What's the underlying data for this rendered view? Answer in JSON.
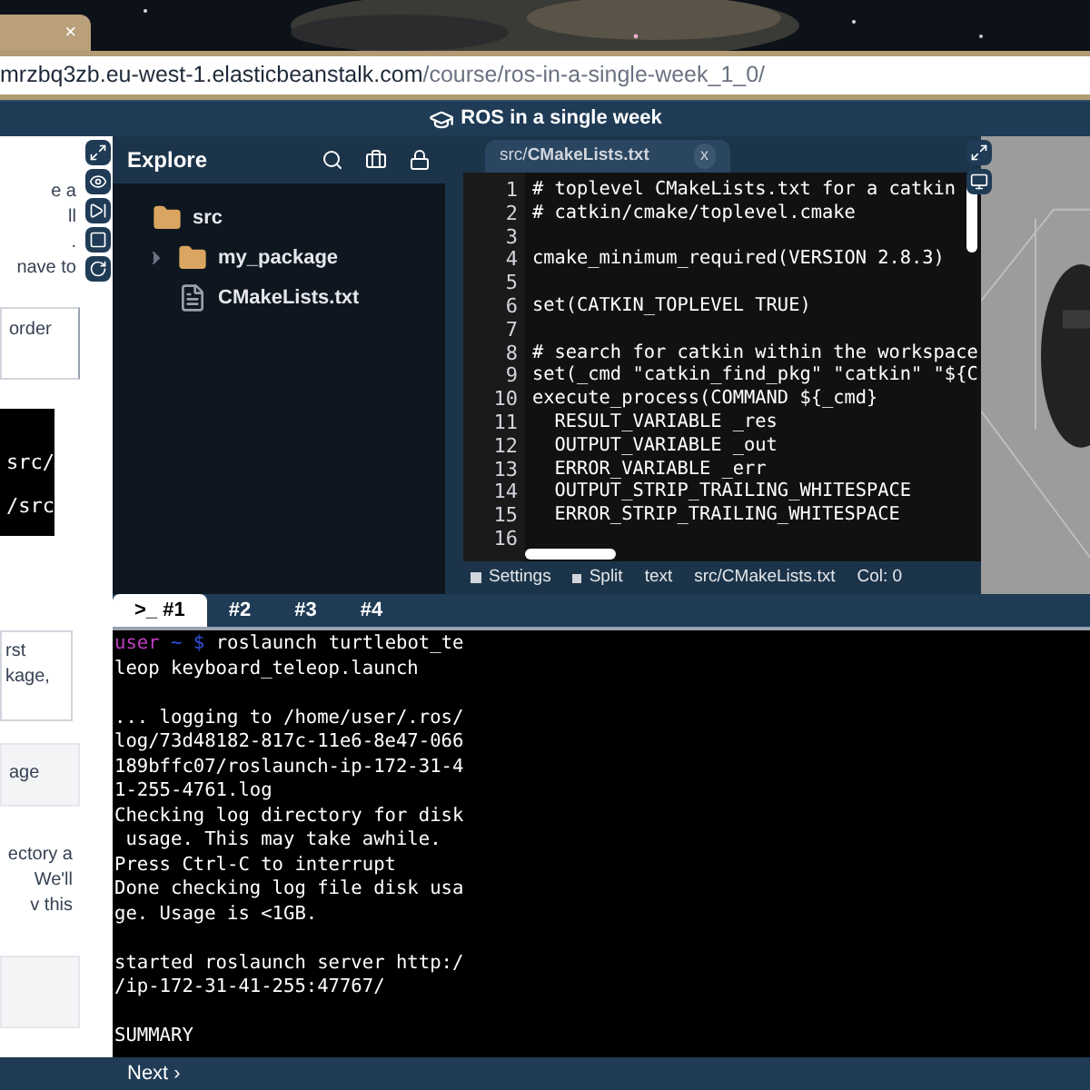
{
  "browser": {
    "tab_close": "×",
    "url_host": "mrzbq3zb.eu-west-1.elasticbeanstalk.com",
    "url_path": "/course/ros-in-a-single-week_1_0/"
  },
  "header": {
    "title": "ROS in a single week"
  },
  "lesson": {
    "upper_text": [
      "e a",
      "ll",
      ".",
      "nave to"
    ],
    "upper_box": "order",
    "code_lines": [
      "src/",
      "/src"
    ],
    "lower_box": [
      "rst",
      "kage,"
    ],
    "grey_box": "age",
    "lower_text": [
      "ectory a",
      "We'll",
      "v this"
    ]
  },
  "explorer": {
    "title": "Explore",
    "tree": [
      {
        "name": "src",
        "kind": "folder",
        "children": [
          {
            "name": "my_package",
            "kind": "folder",
            "expanded": false
          },
          {
            "name": "CMakeLists.txt",
            "kind": "file"
          }
        ]
      }
    ]
  },
  "editor": {
    "tab": "src/**CMakeLists.txt**",
    "close": "x",
    "lines": [
      {
        "number": "1",
        "code": "# toplevel CMakeLists.txt for a catkin"
      },
      {
        "number": "2",
        "code": "# catkin/cmake/toplevel.cmake"
      },
      {
        "number": "3"
      },
      {
        "number": "4",
        "code": "cmake_minimum_required(VERSION 2.8.3)"
      },
      {
        "number": "5"
      },
      {
        "number": "6",
        "code": "set(CATKIN_TOPLEVEL TRUE)"
      },
      {
        "number": "7"
      },
      {
        "number": "8",
        "code": "# search for catkin within the workspace"
      },
      {
        "number": "9",
        "code": "set(_cmd \"catkin_find_pkg\" \"catkin\" \"${C"
      },
      {
        "number": "10",
        "code": "execute_process(COMMAND ${_cmd}"
      },
      {
        "number": "11",
        "code": "  RESULT_VARIABLE _res"
      },
      {
        "number": "12",
        "code": "  OUTPUT_VARIABLE _out"
      },
      {
        "number": "13",
        "code": "  ERROR_VARIABLE _err"
      },
      {
        "number": "14",
        "code": "  OUTPUT_STRIP_TRAILING_WHITESPACE"
      },
      {
        "number": "15",
        "code": "  ERROR_STRIP_TRAILING_WHITESPACE"
      },
      {
        "number": "16"
      }
    ],
    "status": {
      "settings": "Settings",
      "split": "Split",
      "mode": "text",
      "file": "src/CMakeLists.txt",
      "position": "Col: 0"
    }
  },
  "terminal": {
    "tabs": [
      {
        "label": ">_ #1",
        "selected": true
      },
      {
        "label": "#2",
        "selected": false
      },
      {
        "label": "#3",
        "selected": false
      },
      {
        "label": "#4",
        "selected": false
      }
    ],
    "prompt_user": "user",
    "prompt_path": "~ $",
    "command": "roslaunch turtlebot_te",
    "lines": [
      {
        "text": "leop keyboard_teleop.launch"
      },
      {
        "kind": "blank"
      },
      {
        "text": "... logging to /home/user/.ros/"
      },
      {
        "text": "log/73d48182-817c-11e6-8e47-066"
      },
      {
        "text": "189bffc07/roslaunch-ip-172-31-4"
      },
      {
        "text": "1-255-4761.log"
      },
      {
        "text": "Checking log directory for disk"
      },
      {
        "text": " usage. This may take awhile."
      },
      {
        "text": "Press Ctrl-C to interrupt"
      },
      {
        "text": "Done checking log file disk usa"
      },
      {
        "text": "ge. Usage is <1GB."
      },
      {
        "kind": "blank"
      },
      {
        "text": "started roslaunch server http:/"
      },
      {
        "text": "/ip-172-31-41-255:47767/"
      },
      {
        "kind": "blank"
      },
      {
        "text": "SUMMARY"
      }
    ]
  },
  "footer": {
    "next": "Next ›"
  }
}
